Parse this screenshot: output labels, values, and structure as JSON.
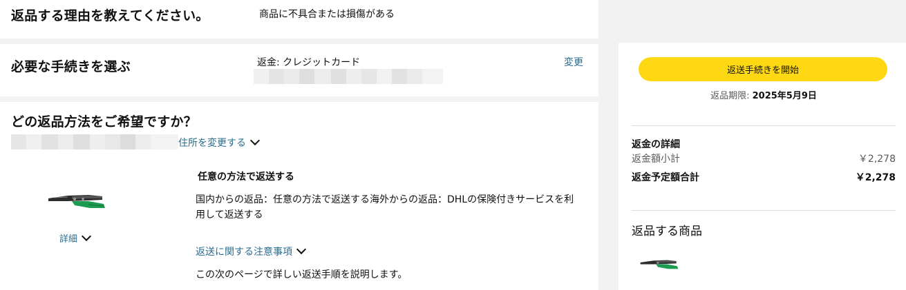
{
  "reason": {
    "heading": "返品する理由を教えてください。",
    "value": "商品に不具合または損傷がある"
  },
  "procedure": {
    "heading": "必要な手続きを選ぶ",
    "refund": "返金: クレジットカード",
    "change_link": "変更"
  },
  "method": {
    "heading": "どの返品方法をご希望ですか？",
    "change_address_link": "住所を変更する",
    "details_link": "詳細",
    "option_title": "任意の方法で返送する",
    "option_desc": "国内からの返品：任意の方法で返送する海外からの返品：DHLの保険付きサービスを利用して返送する",
    "notes_link": "返送に関する注意事項",
    "next_page_note": "この次のページで詳しい返送手順を説明します。"
  },
  "sidebar": {
    "start_button": "返送手続きを開始",
    "deadline_label": "返品期限:",
    "deadline_date": "2025年5月9日",
    "refund_details_heading": "返金の詳細",
    "subtotal_label": "返金額小計",
    "subtotal_value": "￥2,278",
    "total_label": "返金予定額合計",
    "total_value": "￥2,278",
    "items_heading": "返品する商品"
  },
  "colors": {
    "accent_button": "#ffd814",
    "link": "#2a6c8f",
    "background": "#f2f2f2"
  },
  "icons": [
    "wire-stripper-product-image",
    "chevron-down-icon"
  ]
}
